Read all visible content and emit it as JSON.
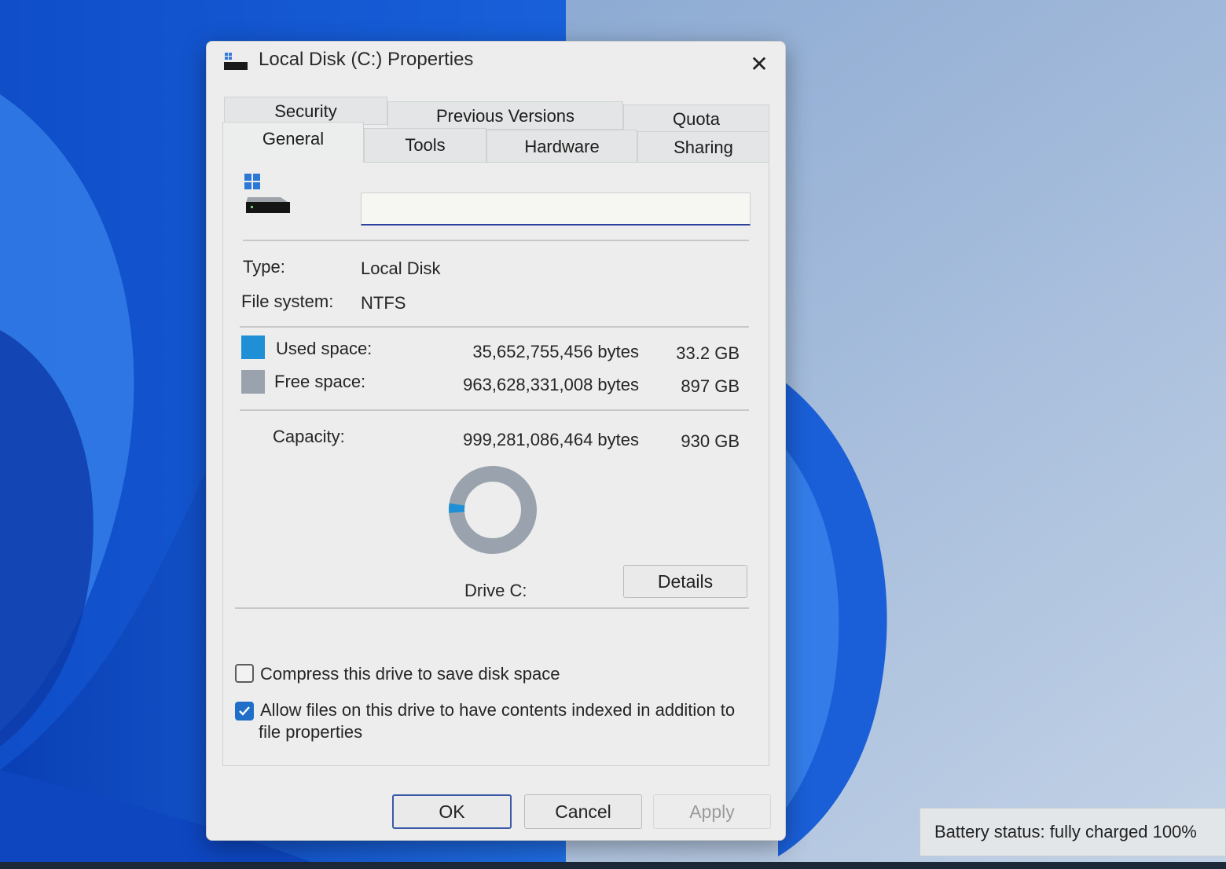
{
  "colors": {
    "used_space": "#1f8fd6",
    "free_space": "#9aa3ad",
    "accent": "#1f6fc9"
  },
  "window": {
    "title": "Local Disk (C:) Properties",
    "icon": "drive-icon",
    "close_icon": "close-icon"
  },
  "tabs": {
    "row1": [
      "Security",
      "Previous Versions",
      "Quota"
    ],
    "row2": [
      "General",
      "Tools",
      "Hardware",
      "Sharing"
    ],
    "active": "General"
  },
  "general": {
    "drive_name_value": "",
    "type_label": "Type:",
    "type_value": "Local Disk",
    "fs_label": "File system:",
    "fs_value": "NTFS",
    "used_label": "Used space:",
    "used_bytes": "35,652,755,456 bytes",
    "used_gb": "33.2 GB",
    "free_label": "Free space:",
    "free_bytes": "963,628,331,008 bytes",
    "free_gb": "897 GB",
    "capacity_label": "Capacity:",
    "capacity_bytes": "999,281,086,464 bytes",
    "capacity_gb": "930 GB",
    "used_fraction": 0.0357,
    "drive_label": "Drive C:",
    "details_button": "Details",
    "compress_label": "Compress this drive to save disk space",
    "compress_checked": false,
    "index_label_line1": "Allow files on this drive to have contents indexed in addition to",
    "index_label_line2": "file properties",
    "index_checked": true
  },
  "buttons": {
    "ok": "OK",
    "cancel": "Cancel",
    "apply": "Apply"
  },
  "tray": {
    "battery_status": "Battery status: fully charged 100%"
  }
}
